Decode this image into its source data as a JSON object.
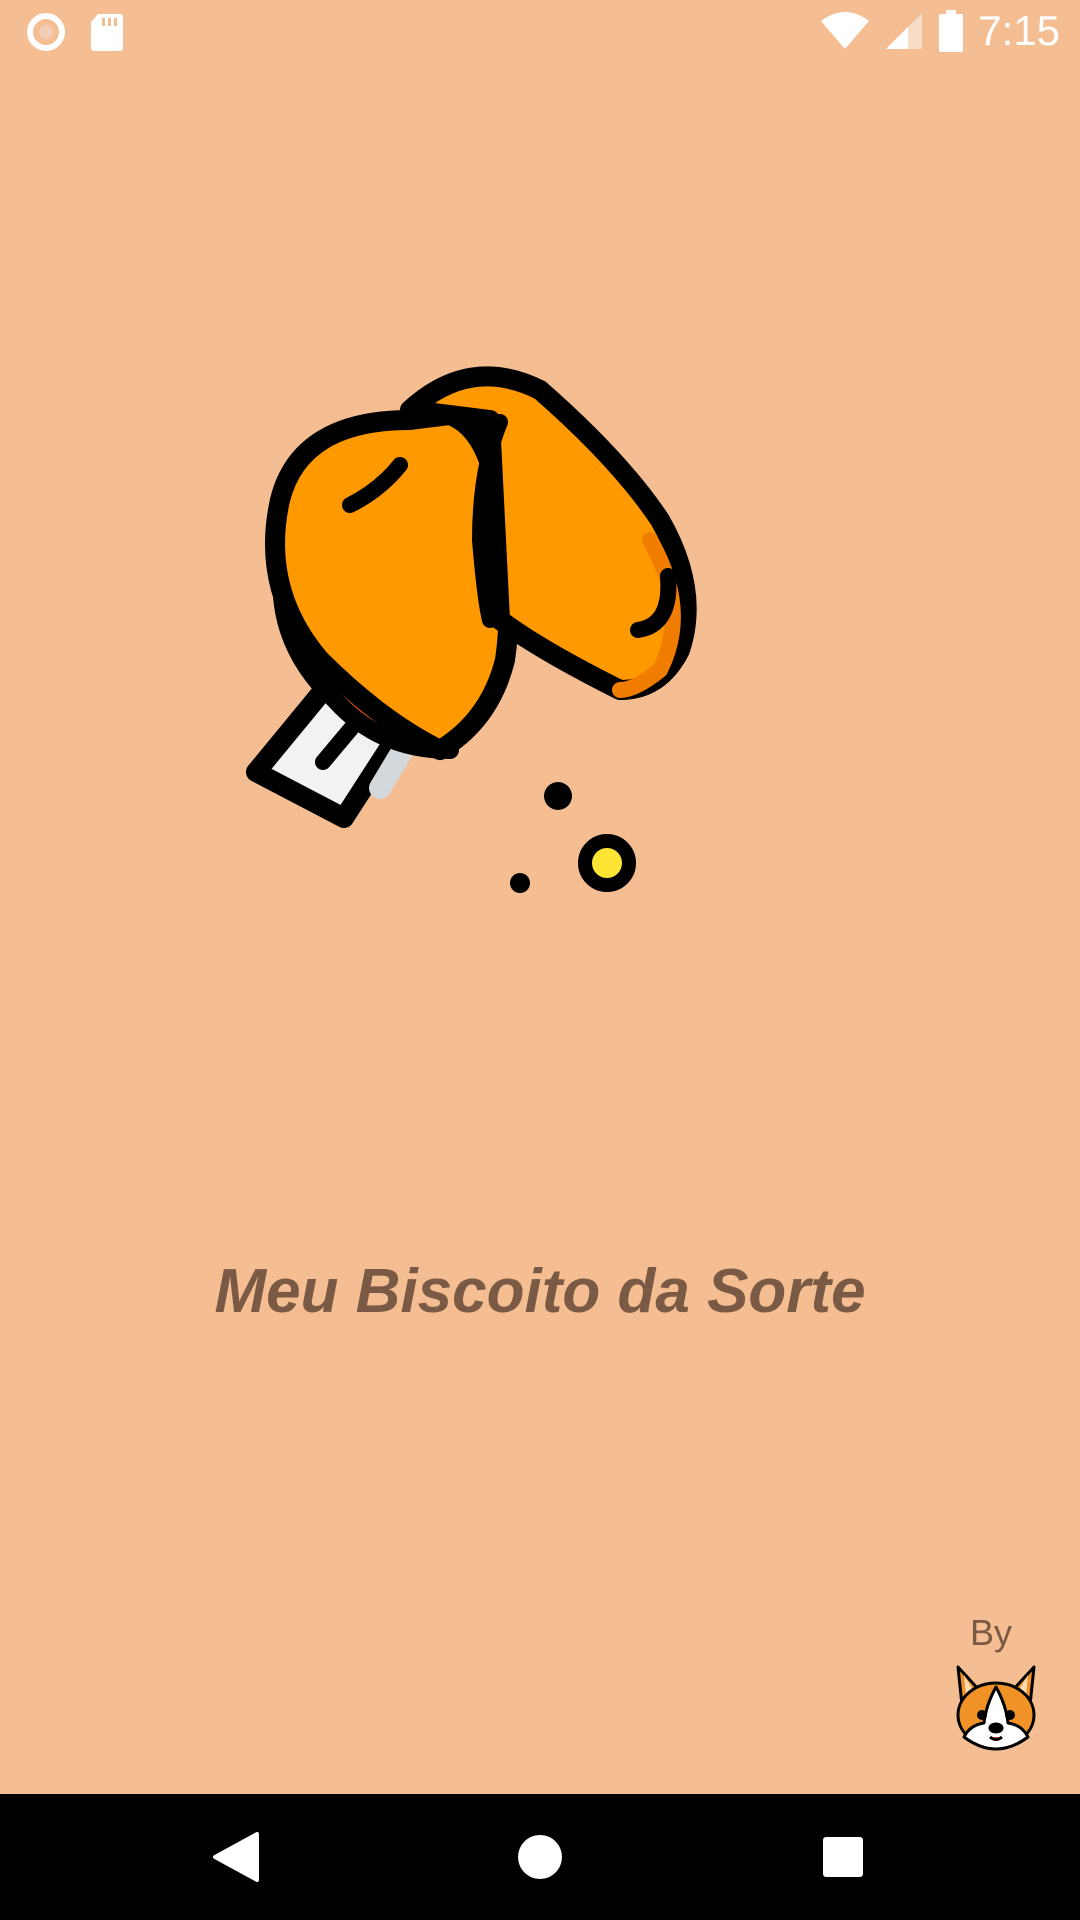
{
  "status_bar": {
    "time": "7:15",
    "icons": [
      "record-icon",
      "sd-card-icon",
      "wifi-icon",
      "signal-icon",
      "battery-icon"
    ]
  },
  "splash": {
    "app_title": "Meu Biscoito da Sorte",
    "logo_icon": "fortune-cookie-icon",
    "by_label": "By",
    "author_logo_icon": "corgi-icon"
  },
  "nav_bar": {
    "buttons": [
      "back-icon",
      "home-icon",
      "recents-icon"
    ]
  },
  "colors": {
    "background": "#F4BE92",
    "title": "#7A5A44",
    "cookie": "#FF9900",
    "cookie_inner": "#D94A17"
  }
}
